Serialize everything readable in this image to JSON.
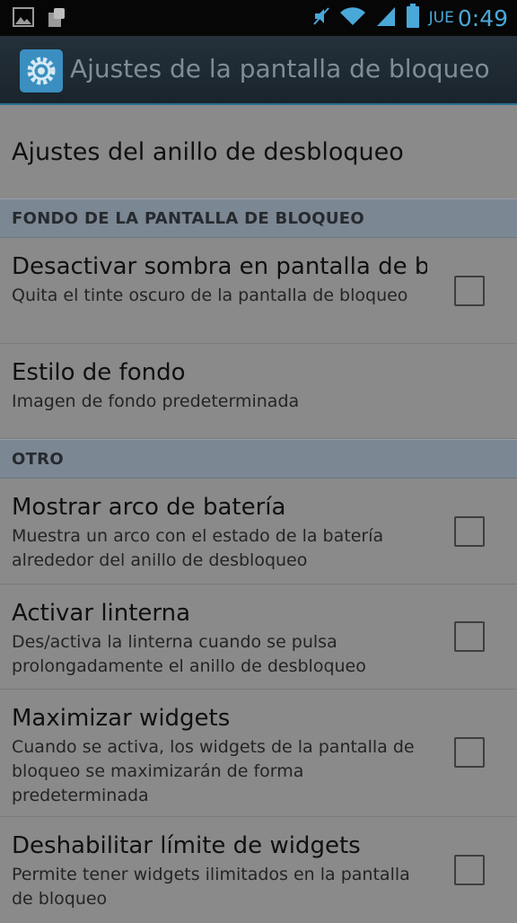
{
  "status_bar": {
    "day": "JUE",
    "time": "0:49",
    "icons": [
      "image-icon",
      "notification-icon",
      "mute-icon",
      "wifi-icon",
      "signal-icon",
      "battery-icon"
    ]
  },
  "action_bar": {
    "icon": "settings-gear-icon",
    "title": "Ajustes de la pantalla de bloqueo"
  },
  "items": {
    "ring": {
      "title": "Ajustes del anillo de desbloqueo"
    },
    "section_bg": {
      "header": "FONDO DE LA PANTALLA DE BLOQUEO"
    },
    "shadow": {
      "title": "Desactivar sombra en pantalla de bloqueo",
      "subtitle": "Quita el tinte oscuro de la pantalla de bloqueo",
      "checked": false
    },
    "bg_style": {
      "title": "Estilo de fondo",
      "subtitle": "Imagen de fondo predeterminada"
    },
    "section_other": {
      "header": "OTRO"
    },
    "battery_arc": {
      "title": "Mostrar arco de batería",
      "subtitle": "Muestra un arco con el estado de la batería alrededor del anillo de desbloqueo",
      "checked": false
    },
    "flashlight": {
      "title": "Activar linterna",
      "subtitle": "Des/activa la linterna cuando se pulsa prolongadamente el anillo de desbloqueo",
      "checked": false
    },
    "maximize": {
      "title": "Maximizar widgets",
      "subtitle": "Cuando se activa, los widgets de la pantalla de bloqueo se maximizarán de forma predeterminada",
      "checked": false
    },
    "widget_limit": {
      "title": "Deshabilitar límite de widgets",
      "subtitle": "Permite tener widgets ilimitados en la pantalla de bloqueo",
      "checked": false
    }
  },
  "colors": {
    "accent": "#4aa8d8",
    "header_bg": "#7b8792",
    "dim_overlay_bg": "#8a8a8a"
  }
}
